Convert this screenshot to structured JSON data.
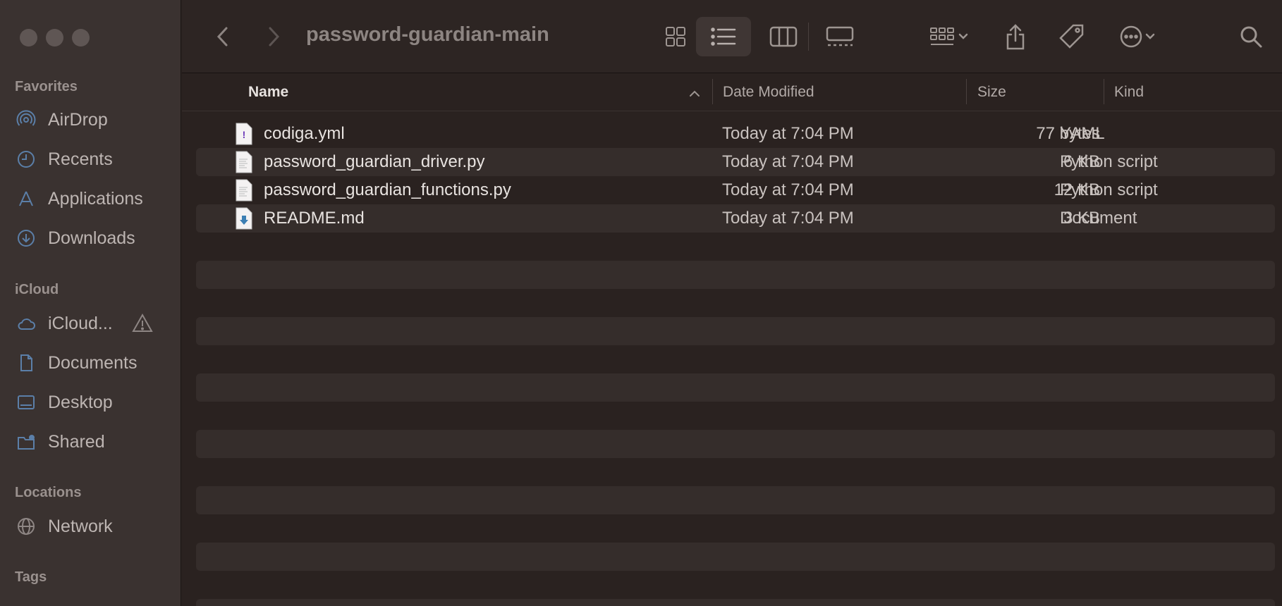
{
  "window": {
    "title": "password-guardian-main"
  },
  "sidebar": {
    "sections": {
      "favorites": "Favorites",
      "icloud": "iCloud",
      "locations": "Locations",
      "tags": "Tags"
    },
    "items": [
      {
        "label": "AirDrop",
        "icon": "airdrop-icon"
      },
      {
        "label": "Recents",
        "icon": "clock-icon"
      },
      {
        "label": "Applications",
        "icon": "applications-icon"
      },
      {
        "label": "Downloads",
        "icon": "download-icon"
      },
      {
        "label": "iCloud...",
        "icon": "cloud-icon"
      },
      {
        "label": "Documents",
        "icon": "document-icon"
      },
      {
        "label": "Desktop",
        "icon": "desktop-icon"
      },
      {
        "label": "Shared",
        "icon": "shared-folder-icon"
      },
      {
        "label": "Network",
        "icon": "network-globe-icon"
      }
    ]
  },
  "columns": {
    "name": "Name",
    "date": "Date Modified",
    "size": "Size",
    "kind": "Kind"
  },
  "files": [
    {
      "name": "codiga.yml",
      "date": "Today at 7:04 PM",
      "size": "77 bytes",
      "kind": "YAML",
      "icon": "yaml-file-icon"
    },
    {
      "name": "password_guardian_driver.py",
      "date": "Today at 7:04 PM",
      "size": "6 KB",
      "kind": "Python script",
      "icon": "python-file-icon"
    },
    {
      "name": "password_guardian_functions.py",
      "date": "Today at 7:04 PM",
      "size": "12 KB",
      "kind": "Python script",
      "icon": "python-file-icon"
    },
    {
      "name": "README.md",
      "date": "Today at 7:04 PM",
      "size": "3 KB",
      "kind": "Document",
      "icon": "markdown-file-icon"
    }
  ],
  "colors": {
    "sidebar_bg": "#3a3230",
    "main_bg": "#2a2220",
    "icon_blue": "#5b7fa8"
  }
}
